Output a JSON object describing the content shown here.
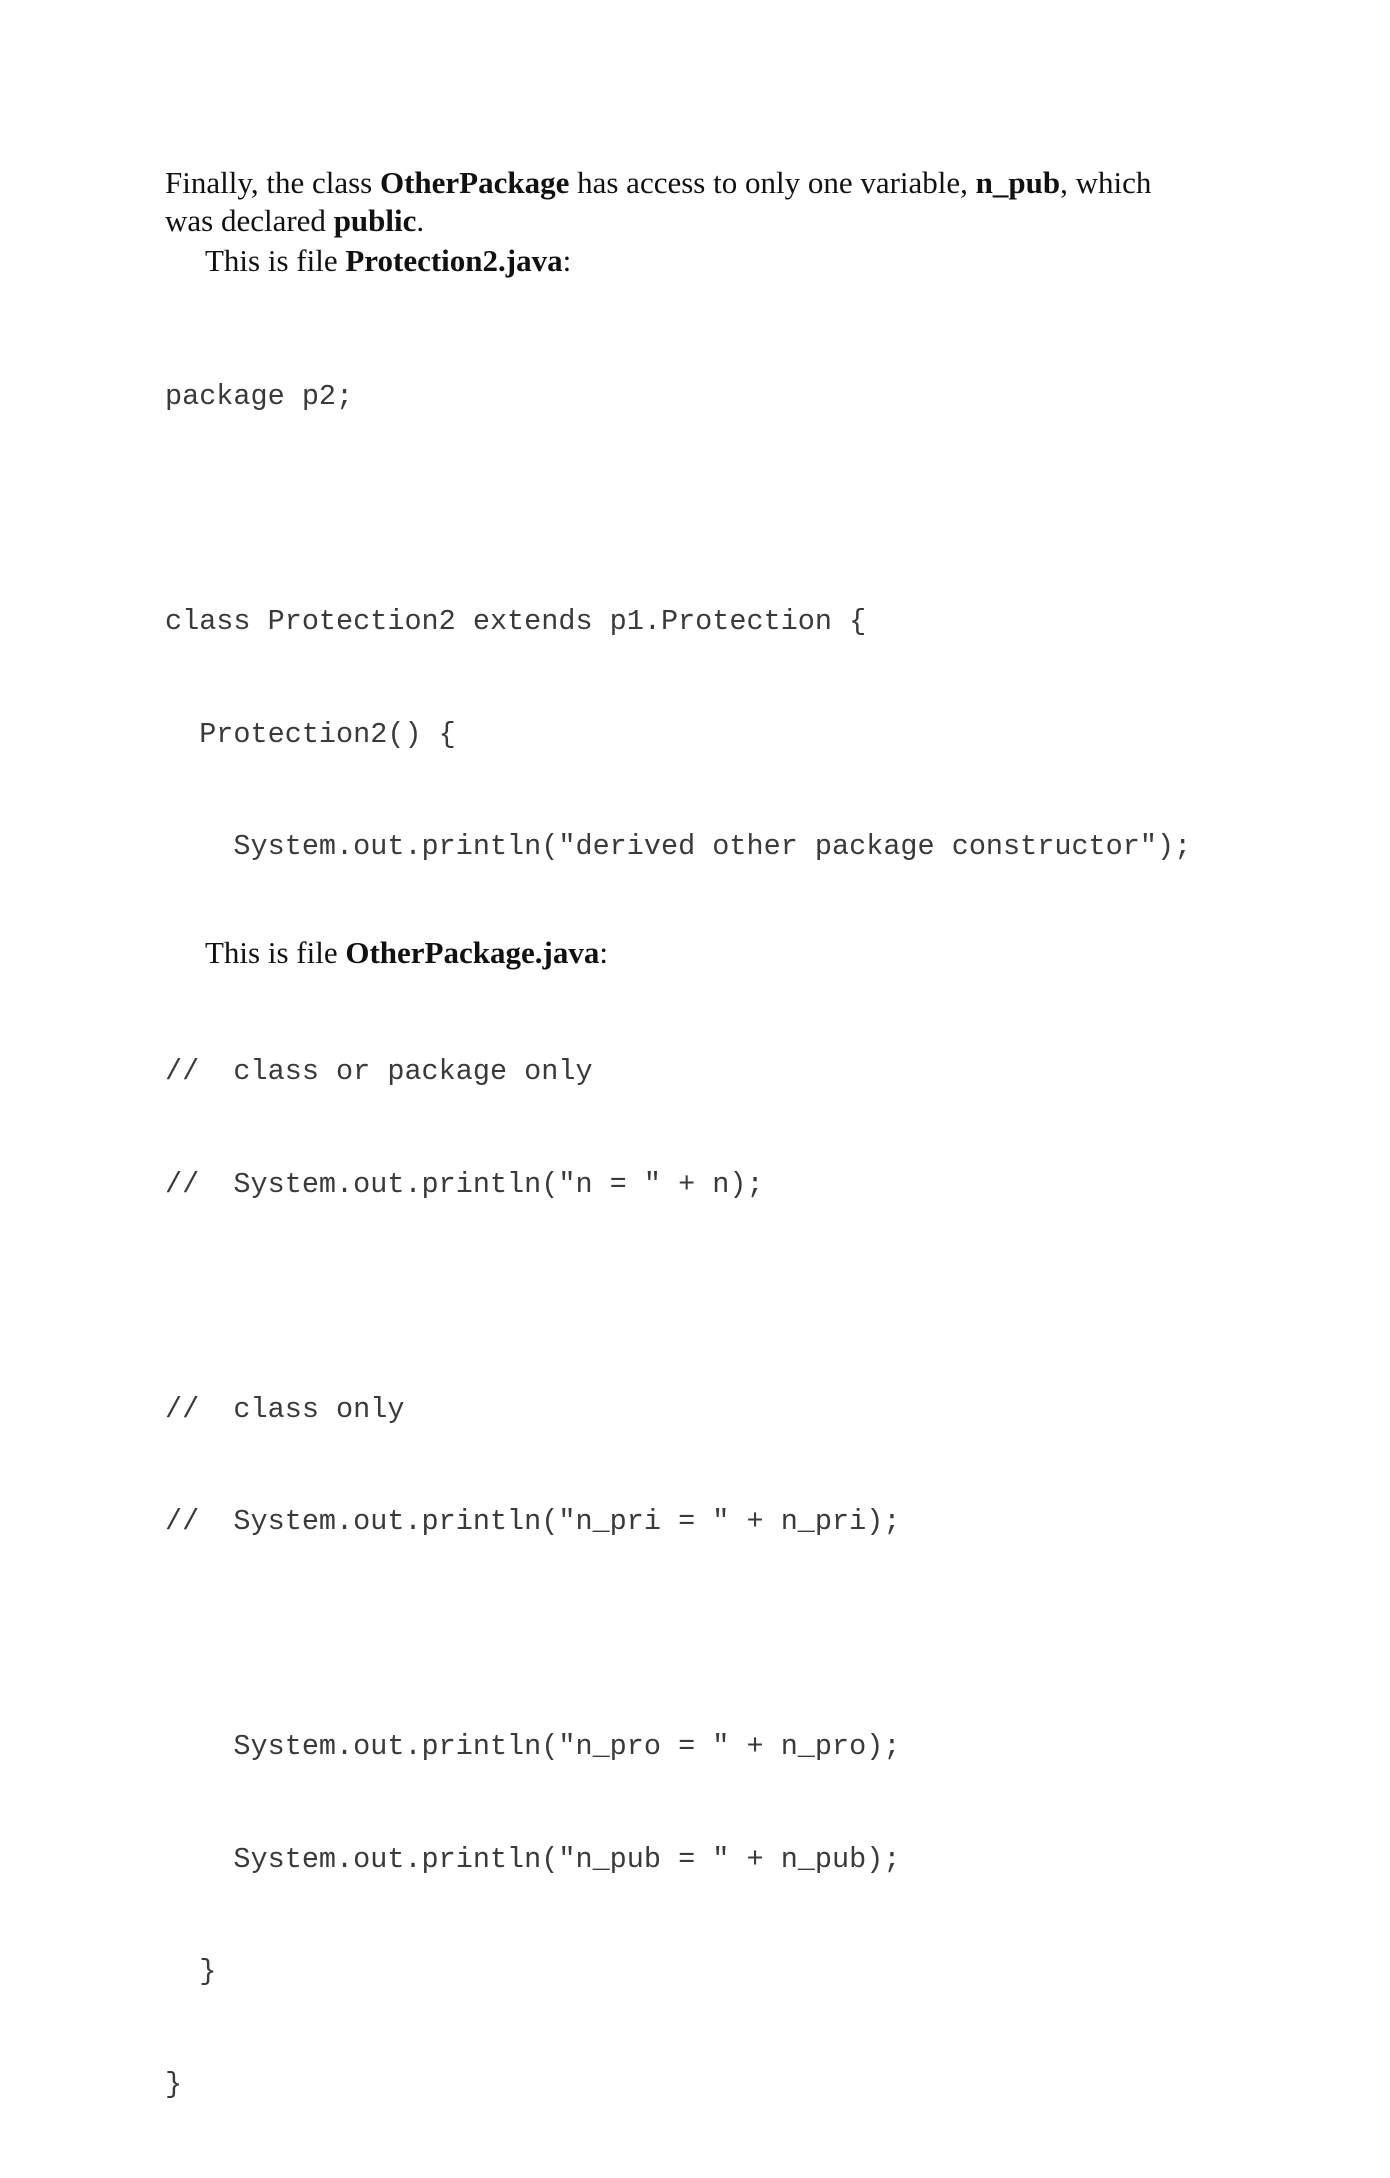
{
  "intro": {
    "p1_a": "Finally, the class ",
    "p1_b": "OtherPackage",
    "p1_c": " has access to only one variable, ",
    "p1_d": "n_pub",
    "p1_e": ", which",
    "p1_f": "was declared ",
    "p1_g": "public",
    "p1_h": "."
  },
  "file1": {
    "prefix": "This is file ",
    "name": "Protection2.java",
    "suffix": ":"
  },
  "code": {
    "lines": [
      "package p2;",
      "",
      "class Protection2 extends p1.Protection {",
      "  Protection2() {",
      "    System.out.println(\"derived other package constructor\");",
      "",
      "//  class or package only",
      "//  System.out.println(\"n = \" + n);",
      "",
      "//  class only",
      "//  System.out.println(\"n_pri = \" + n_pri);",
      "",
      "    System.out.println(\"n_pro = \" + n_pro);",
      "    System.out.println(\"n_pub = \" + n_pub);",
      "  }",
      "}"
    ]
  },
  "file2": {
    "prefix": "This is file ",
    "name": "OtherPackage.java",
    "suffix": ":"
  }
}
